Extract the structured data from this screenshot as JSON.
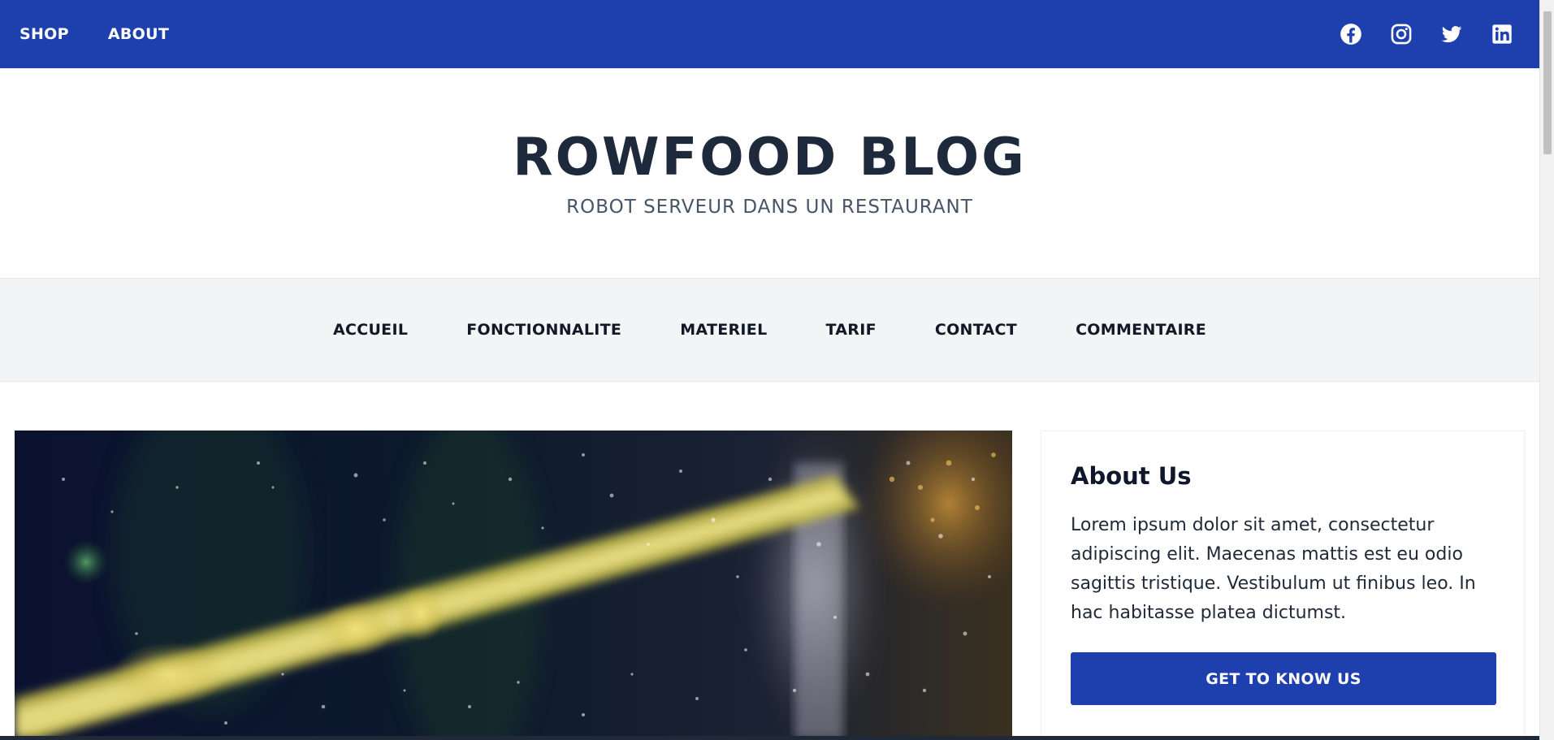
{
  "topbar": {
    "nav": [
      {
        "label": "SHOP"
      },
      {
        "label": "ABOUT"
      }
    ],
    "socials": [
      {
        "icon": "facebook-icon"
      },
      {
        "icon": "instagram-icon"
      },
      {
        "icon": "twitter-icon"
      },
      {
        "icon": "linkedin-icon"
      }
    ]
  },
  "header": {
    "title": "ROWFOOD BLOG",
    "tagline": "ROBOT SERVEUR DANS UN RESTAURANT"
  },
  "main_nav": [
    {
      "label": "ACCUEIL"
    },
    {
      "label": "FONCTIONNALITE"
    },
    {
      "label": "MATERIEL"
    },
    {
      "label": "TARIF"
    },
    {
      "label": "CONTACT"
    },
    {
      "label": "COMMENTAIRE"
    }
  ],
  "sidebar": {
    "about": {
      "title": "About Us",
      "text": "Lorem ipsum dolor sit amet, consectetur adipiscing elit. Maecenas mattis est eu odio sagittis tristique. Vestibulum ut finibus leo. In hac habitasse platea dictumst.",
      "button_label": "GET TO KNOW US"
    }
  },
  "colors": {
    "brand": "#1e40af",
    "nav_bg": "#f3f4f6",
    "title": "#1e293b"
  }
}
